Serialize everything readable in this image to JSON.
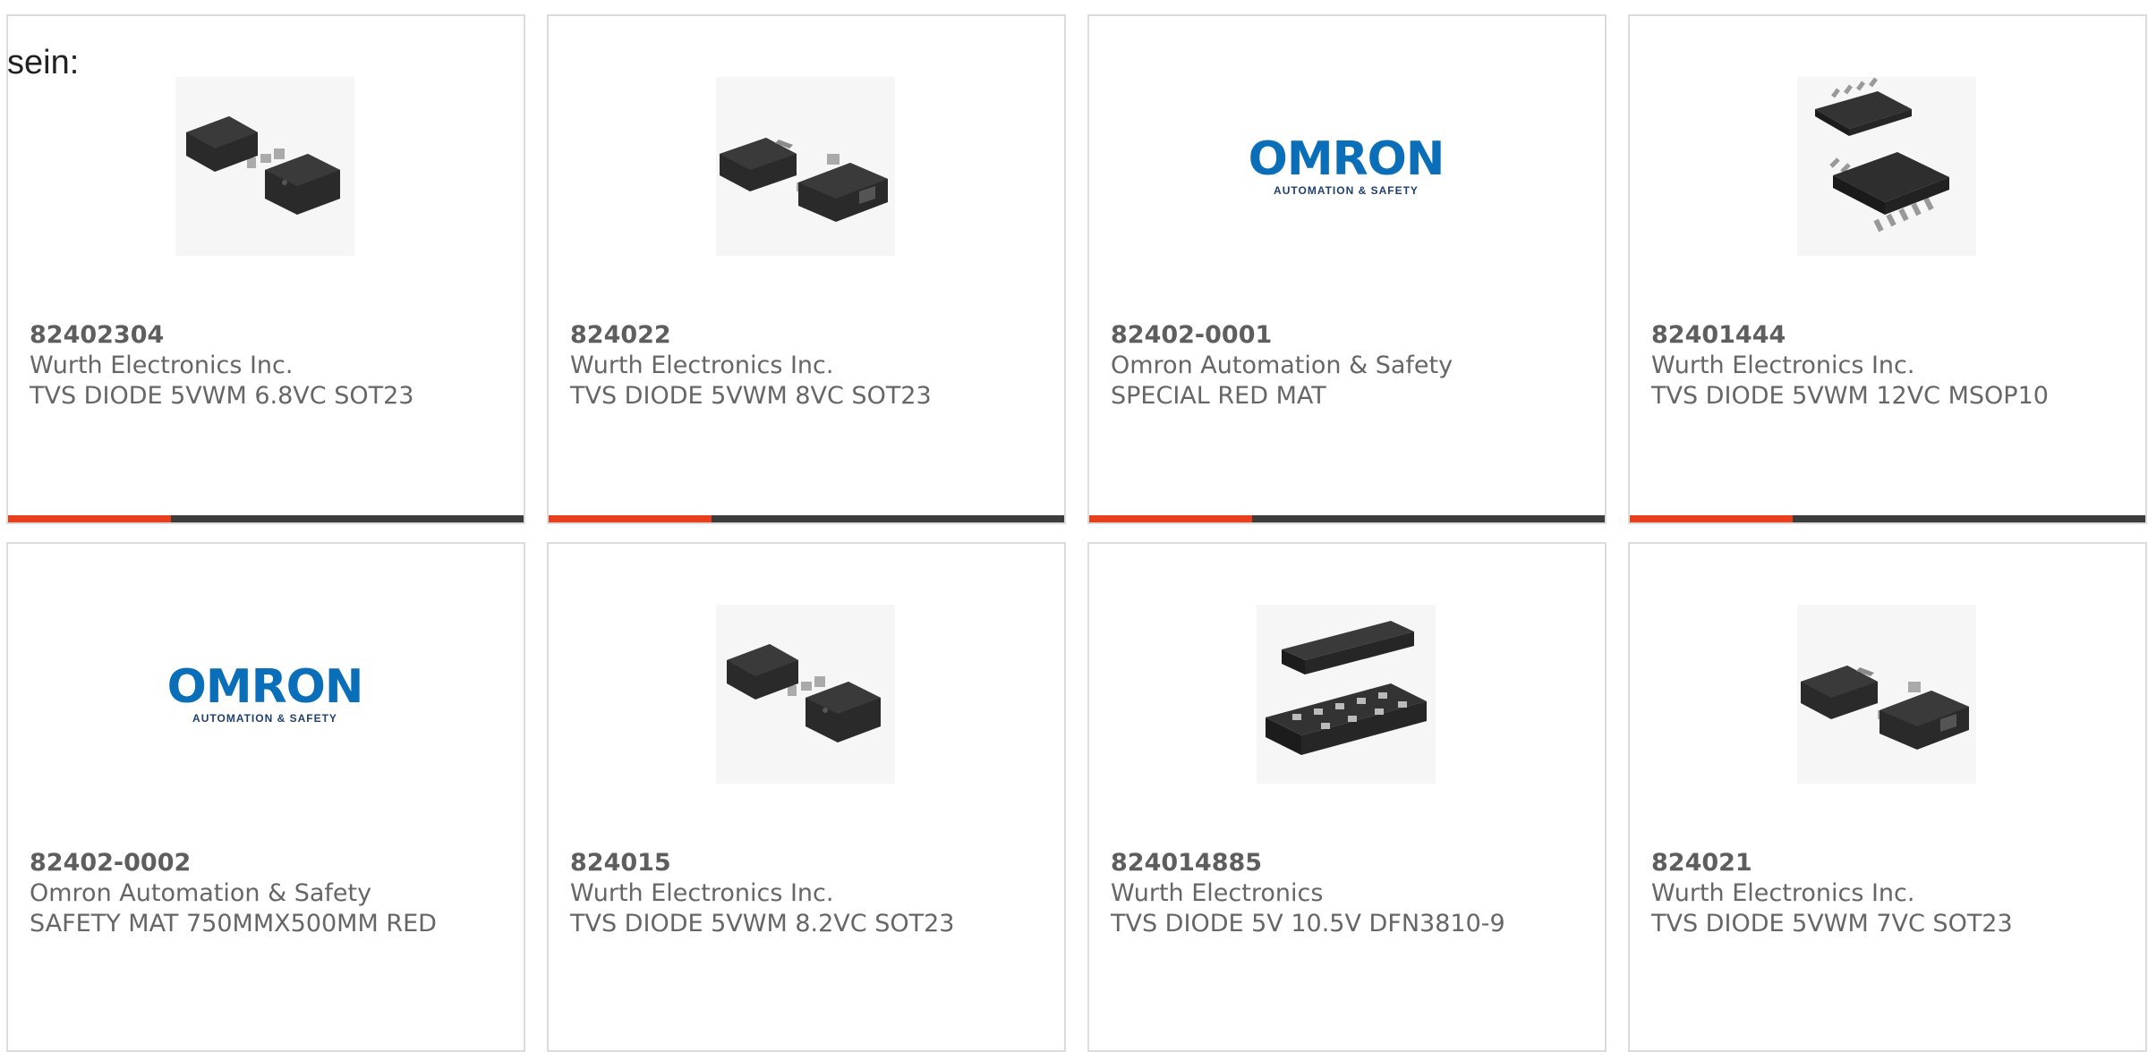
{
  "intro": {
    "text": "sein:"
  },
  "cards": [
    {
      "part_number": "82402304",
      "manufacturer": "Wurth Electronics Inc.",
      "description": "TVS DIODE 5VWM 6.8VC SOT23",
      "image": "sot23-6-package-icon"
    },
    {
      "part_number": "824022",
      "manufacturer": "Wurth Electronics Inc.",
      "description": "TVS DIODE 5VWM 8VC SOT23",
      "image": "sot23-3-package-icon"
    },
    {
      "part_number": "82402-0001",
      "manufacturer": "Omron Automation & Safety",
      "description": "SPECIAL RED MAT",
      "image": "omron-logo",
      "logo_text": "OMRON",
      "logo_subtext": "AUTOMATION & SAFETY"
    },
    {
      "part_number": "82401444",
      "manufacturer": "Wurth Electronics Inc.",
      "description": "TVS DIODE 5VWM 12VC MSOP10",
      "image": "msop10-package-icon"
    },
    {
      "part_number": "82402-0002",
      "manufacturer": "Omron Automation & Safety",
      "description": "SAFETY MAT 750MMX500MM RED",
      "image": "omron-logo",
      "logo_text": "OMRON",
      "logo_subtext": "AUTOMATION & SAFETY"
    },
    {
      "part_number": "824015",
      "manufacturer": "Wurth Electronics Inc.",
      "description": "TVS DIODE 5VWM 8.2VC SOT23",
      "image": "sot23-6-package-icon"
    },
    {
      "part_number": "824014885",
      "manufacturer": "Wurth Electronics",
      "description": "TVS DIODE 5V 10.5V DFN3810-9",
      "image": "dfn3810-package-icon"
    },
    {
      "part_number": "824021",
      "manufacturer": "Wurth Electronics Inc.",
      "description": "TVS DIODE 5VWM 7VC SOT23",
      "image": "sot23-3-package-icon"
    }
  ],
  "colors": {
    "accent": "#e8401c",
    "bar": "#3c3c3c",
    "text": "#666666",
    "omron_blue": "#0a6fb8"
  }
}
